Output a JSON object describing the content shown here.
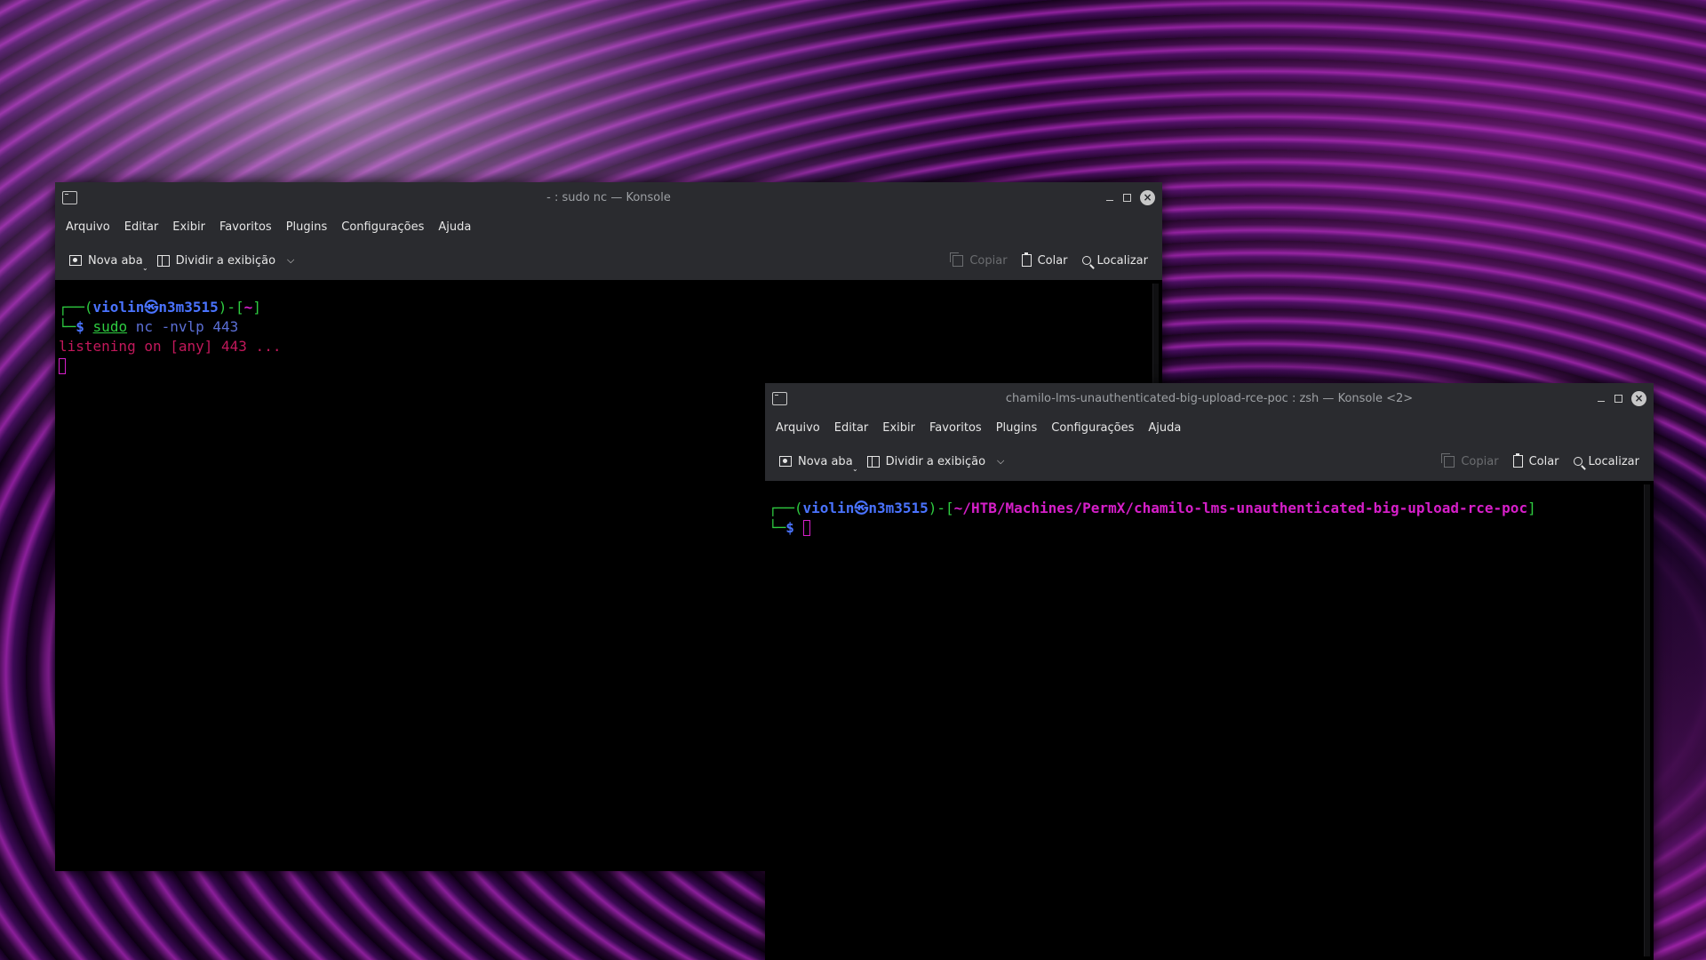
{
  "win1": {
    "title": "- : sudo nc — Konsole",
    "menu": [
      "Arquivo",
      "Editar",
      "Exibir",
      "Favoritos",
      "Plugins",
      "Configurações",
      "Ajuda"
    ],
    "toolbar": {
      "new_tab": "Nova aba",
      "split_view": "Dividir a exibição",
      "copy": "Copiar",
      "paste": "Colar",
      "find": "Localizar"
    },
    "terminal": {
      "prompt_open": "┌──(",
      "user_host": "violin㉿n3m3515",
      "bracket_mid": ")-[",
      "path": "~",
      "bracket_close": "]",
      "prompt_prefix": "└─",
      "prompt_symbol": "$",
      "command": "sudo",
      "args": "nc -nvlp 443",
      "output": "listening on [any] 443 ..."
    }
  },
  "win2": {
    "title": "chamilo-lms-unauthenticated-big-upload-rce-poc : zsh — Konsole <2>",
    "menu": [
      "Arquivo",
      "Editar",
      "Exibir",
      "Favoritos",
      "Plugins",
      "Configurações",
      "Ajuda"
    ],
    "toolbar": {
      "new_tab": "Nova aba",
      "split_view": "Dividir a exibição",
      "copy": "Copiar",
      "paste": "Colar",
      "find": "Localizar"
    },
    "terminal": {
      "prompt_open": "┌──(",
      "user_host": "violin㉿n3m3515",
      "bracket_mid": ")-[",
      "path": "~/HTB/Machines/PermX/chamilo-lms-unauthenticated-big-upload-rce-poc",
      "bracket_close": "]",
      "prompt_prefix": "└─",
      "prompt_symbol": "$"
    }
  },
  "colors": {
    "titlebar": "#2a2b2f",
    "terminal_bg": "#000000",
    "prompt_green": "#2ecc40",
    "prompt_blue": "#4a73ff",
    "path_magenta": "#d61fc9"
  }
}
